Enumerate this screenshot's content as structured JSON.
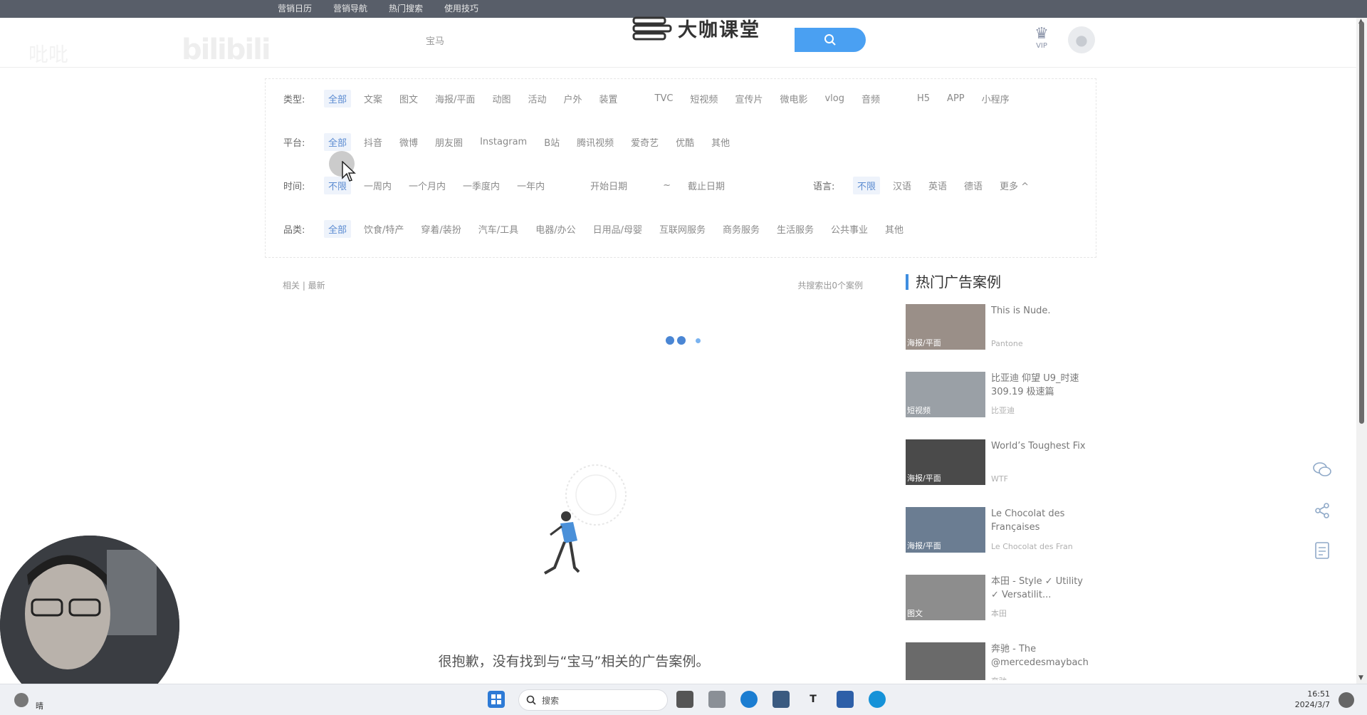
{
  "top_links": [
    "营销日历",
    "营销导航",
    "热门搜索",
    "使用技巧"
  ],
  "watermark": {
    "bili": "bilibili",
    "bili2": "吡吡"
  },
  "search": {
    "value": "宝马"
  },
  "logo_text": "大咖课堂",
  "vip_label": "VIP",
  "filters": {
    "type": {
      "label": "类型:",
      "options": [
        "全部",
        "文案",
        "图文",
        "海报/平面",
        "动图",
        "活动",
        "户外",
        "装置"
      ],
      "options2": [
        "TVC",
        "短视频",
        "宣传片",
        "微电影",
        "vlog",
        "音频"
      ],
      "options3": [
        "H5",
        "APP",
        "小程序"
      ]
    },
    "platform": {
      "label": "平台:",
      "options": [
        "全部",
        "抖音",
        "微博",
        "朋友圈",
        "Instagram",
        "B站",
        "腾讯视频",
        "爱奇艺",
        "优酷",
        "其他"
      ]
    },
    "time": {
      "label": "时间:",
      "options": [
        "不限",
        "一周内",
        "一个月内",
        "一季度内",
        "一年内"
      ],
      "start": "开始日期",
      "sep": "~",
      "end": "截止日期",
      "lang_label": "语言:",
      "lang_options": [
        "不限",
        "汉语",
        "英语",
        "德语"
      ],
      "more": "更多 ^"
    },
    "category": {
      "label": "品类:",
      "options": [
        "全部",
        "饮食/特产",
        "穿着/装扮",
        "汽车/工具",
        "电器/办公",
        "日用品/母婴",
        "互联网服务",
        "商务服务",
        "生活服务",
        "公共事业",
        "其他"
      ]
    }
  },
  "results": {
    "sort": "相关 | 最新",
    "count": "共搜索出0个案例",
    "empty_message": "很抱歉，没有找到与“宝马”相关的广告案例。"
  },
  "hot": {
    "title": "热门广告案例",
    "items": [
      {
        "title": "This is Nude.",
        "brand": "Pantone",
        "tag": "海报/平面",
        "color": "#9a8f88"
      },
      {
        "title": "比亚迪 仰望 U9_时速309.19 极速篇",
        "brand": "比亚迪",
        "tag": "短视频",
        "color": "#9aa0a6"
      },
      {
        "title": "World’s Toughest Fix",
        "brand": "WTF",
        "tag": "海报/平面",
        "color": "#4a4a4a"
      },
      {
        "title": "Le Chocolat des Françaises",
        "brand": "Le Chocolat des Fran",
        "tag": "海报/平面",
        "color": "#6b7d92"
      },
      {
        "title": "本田 - Style ✓ Utility ✓ Versatilit...",
        "brand": "本田",
        "tag": "图文",
        "color": "#8d8d8d"
      },
      {
        "title": "奔驰 - The @mercedesmaybach",
        "brand": "奔驰",
        "tag": "",
        "color": "#6a6a6a"
      }
    ]
  },
  "taskbar": {
    "search": "搜索",
    "time": "16:51",
    "date": "2024/3/7",
    "tray_text": "晴"
  }
}
